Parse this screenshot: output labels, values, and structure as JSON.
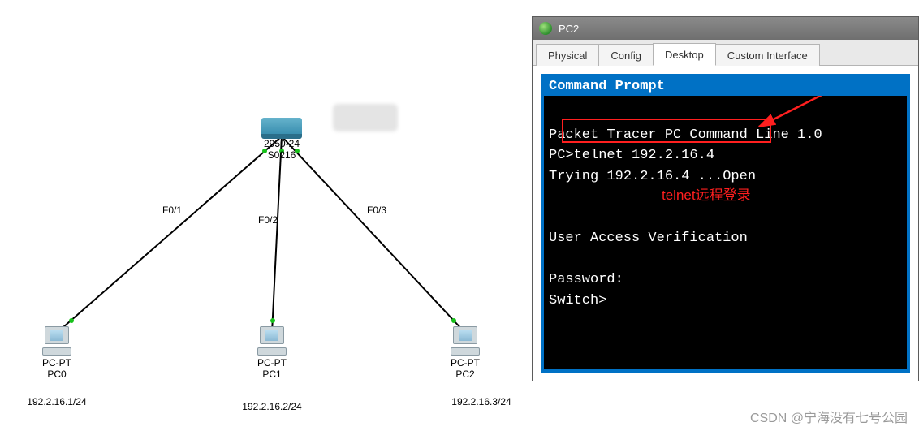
{
  "topology": {
    "switch": {
      "name": "2950-24",
      "host": "S0216"
    },
    "links": {
      "l1": "F0/1",
      "l2": "F0/2",
      "l3": "F0/3"
    },
    "pcs": [
      {
        "type": "PC-PT",
        "name": "PC0",
        "ip": "192.2.16.1/24"
      },
      {
        "type": "PC-PT",
        "name": "PC1",
        "ip": "192.2.16.2/24"
      },
      {
        "type": "PC-PT",
        "name": "PC2",
        "ip": "192.2.16.3/24"
      }
    ]
  },
  "window": {
    "title": "PC2",
    "tabs": [
      "Physical",
      "Config",
      "Desktop",
      "Custom Interface"
    ],
    "active_tab": 2,
    "command_prompt": {
      "header": "Command Prompt",
      "lines": [
        "Packet Tracer PC Command Line 1.0",
        "PC>telnet 192.2.16.4",
        "Trying 192.2.16.4 ...Open",
        "",
        "",
        "User Access Verification",
        "",
        "Password:",
        "Switch>"
      ]
    }
  },
  "annotation": {
    "text": "telnet远程登录"
  },
  "watermark": "CSDN @宁海没有七号公园"
}
